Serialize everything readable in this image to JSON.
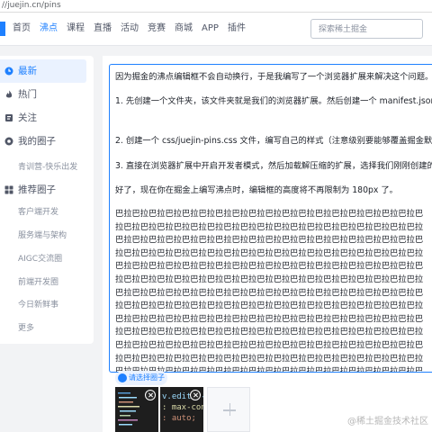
{
  "browser": {
    "url": "//juejin.cn/pins"
  },
  "nav": {
    "items": [
      {
        "label": "首页"
      },
      {
        "label": "沸点"
      },
      {
        "label": "课程"
      },
      {
        "label": "直播"
      },
      {
        "label": "活动"
      },
      {
        "label": "竞赛"
      },
      {
        "label": "商城"
      },
      {
        "label": "APP"
      },
      {
        "label": "插件"
      }
    ],
    "active_index": 1,
    "search_placeholder": "探索稀土掘金"
  },
  "sidebar": {
    "items": [
      {
        "label": "最新",
        "icon": "clock-icon",
        "active": true
      },
      {
        "label": "热门",
        "icon": "flame-icon",
        "active": false
      },
      {
        "label": "关注",
        "icon": "follow-icon",
        "active": false
      },
      {
        "label": "我的圈子",
        "icon": "circle-icon",
        "active": false
      }
    ],
    "my_circles": [
      "青训营-快乐出发"
    ],
    "recommend_title": "推荐圈子",
    "recommend_icon": "grid-icon",
    "recommend_circles": [
      "客户端开发",
      "服务端与架构",
      "AIGC交流圈",
      "前端开发圈",
      "今日新鲜事",
      "更多"
    ]
  },
  "editor": {
    "paragraphs": [
      "因为掘金的沸点编辑框不会自动换行，于是我编写了一个浏览器扩展来解决这个问题。步骤极其简单",
      "1. 先创建一个文件夹，该文件夹就是我们的浏览器扩展。然后创建一个 manifest.json 文件，内容如下所示。",
      "2. 创建一个 css/juejin-pins.css 文件，编写自己的样式（注意级别要能够覆盖掘金默认样式级别）",
      "3. 直接在浏览器扩展中开启开发者模式，然后加载解压缩的扩展，选择我们刚刚创建的文件夹就可以了。",
      "好了，现在你在掘金上编写沸点时，编辑框的高度将不再限制为 180px 了。"
    ],
    "filler": "巴拉巴拉巴拉巴拉巴拉巴拉巴拉巴拉巴拉巴拉巴拉巴拉巴拉巴拉巴拉巴拉巴拉巴拉巴拉巴拉巴拉巴拉巴拉巴拉巴拉巴拉巴拉巴拉巴拉巴拉巴拉巴拉巴拉巴拉巴拉巴拉巴拉巴拉巴拉巴拉巴拉巴拉巴拉巴拉巴拉巴拉巴拉巴拉巴拉巴拉巴拉巴拉巴拉巴拉巴拉巴拉巴拉巴拉巴拉巴拉巴拉巴拉巴拉巴拉巴拉巴拉巴拉巴拉巴拉巴拉巴拉巴拉巴拉巴拉巴拉巴拉巴拉巴拉巴拉巴拉巴拉巴拉巴拉巴拉巴拉巴拉巴拉巴拉巴拉巴拉巴拉巴拉巴拉巴拉巴拉巴拉巴拉巴拉巴拉巴拉巴拉巴拉巴拉巴拉巴拉巴拉巴拉巴拉巴拉巴拉巴拉巴拉巴拉巴拉巴拉巴拉巴拉巴拉巴拉巴拉巴拉巴拉巴拉巴拉巴拉巴拉巴拉巴拉巴拉巴拉巴拉巴拉巴拉巴拉巴拉巴拉巴拉巴拉巴拉巴拉巴拉巴拉巴拉巴拉巴拉巴拉巴拉巴拉巴拉巴拉巴拉巴拉巴拉巴拉巴拉巴拉巴拉巴拉巴拉巴拉巴拉巴拉巴拉巴拉巴拉巴拉巴拉巴拉巴拉巴拉巴拉巴拉巴拉巴拉巴拉巴拉巴拉巴拉巴拉巴拉巴拉巴拉巴拉巴拉巴拉巴拉巴拉巴拉巴拉巴拉巴拉巴拉巴拉巴拉巴拉巴拉巴拉巴拉巴拉巴拉巴拉巴拉巴拉巴拉巴拉巴拉巴拉巴拉巴拉巴拉巴拉巴拉巴拉巴拉巴拉巴拉巴拉巴拉巴拉巴拉巴拉巴拉巴拉巴拉巴拉巴拉巴拉巴拉巴拉巴拉巴拉巴拉巴拉巴拉巴拉巴拉巴拉巴拉巴拉巴拉巴拉巴拉巴拉巴拉巴拉巴拉巴拉巴拉巴拉巴拉巴拉巴拉巴拉巴拉巴拉巴拉巴拉巴拉",
    "circle_button": "请选择圈子",
    "thumbs": [
      {
        "lines": []
      },
      {
        "lines": [
          "v.editor-co",
          ": max-cont",
          ": auto;"
        ]
      }
    ]
  },
  "watermark": "@稀土掘金技术社区",
  "colors": {
    "accent": "#1e80ff",
    "text": "#1d2129",
    "muted": "#8a919f"
  }
}
